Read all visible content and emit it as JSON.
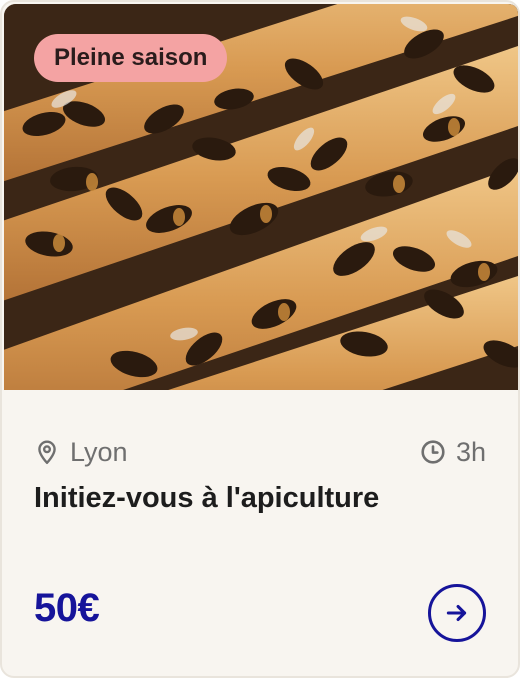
{
  "card": {
    "badge_label": "Pleine saison",
    "location": "Lyon",
    "duration": "3h",
    "title": "Initiez-vous à l'apiculture",
    "price": "50€",
    "photo_subject": "bees on honeycomb frames",
    "icons": {
      "location": "map-pin-icon",
      "duration": "clock-icon",
      "action": "arrow-right-icon"
    }
  },
  "colors": {
    "badge_bg": "#f4a3a3",
    "price": "#16149a",
    "card_bg": "#f8f5f0",
    "meta_text": "#6f6f6f"
  }
}
